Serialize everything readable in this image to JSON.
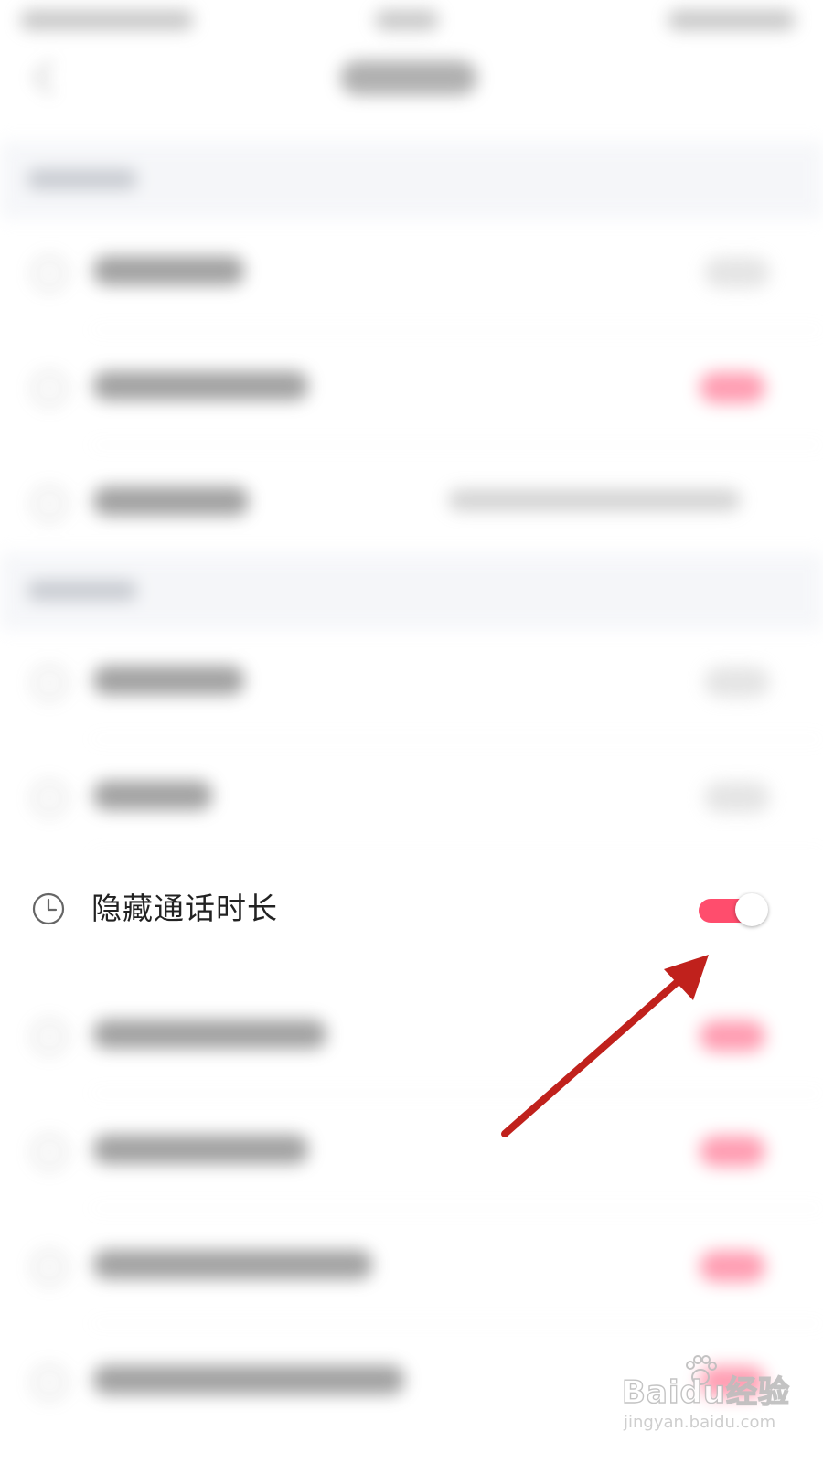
{
  "setting": {
    "label": "隐藏通话时长",
    "icon": "clock-icon",
    "enabled": true,
    "accent_color": "#ff4d6d"
  },
  "annotation": {
    "arrow_color": "#c0211c"
  },
  "watermark": {
    "brand": "Baidu经验",
    "url": "jingyan.baidu.com"
  }
}
